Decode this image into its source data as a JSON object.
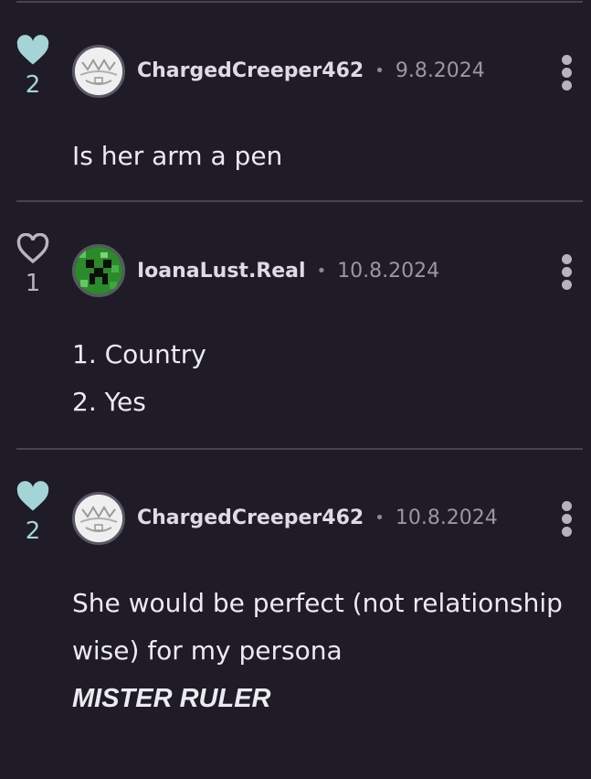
{
  "comments": [
    {
      "username": "ChargedCreeper462",
      "separator": "•",
      "date": "9.8.2024",
      "likes": "2",
      "liked": true,
      "avatar_icon": "white-pattern-avatar",
      "lines": [
        "Is her arm a pen"
      ]
    },
    {
      "username": "IoanaLust.Real",
      "separator": "•",
      "date": "10.8.2024",
      "likes": "1",
      "liked": false,
      "avatar_icon": "creeper-face-avatar",
      "lines": [
        "1. Country",
        "2. Yes"
      ]
    },
    {
      "username": "ChargedCreeper462",
      "separator": "•",
      "date": "10.8.2024",
      "likes": "2",
      "liked": true,
      "avatar_icon": "white-pattern-avatar",
      "lines": [
        "She would be perfect (not relationship wise) for my persona"
      ],
      "emphasis": "MISTER RULER"
    }
  ],
  "colors": {
    "background": "#1f1b27",
    "liked_heart": "#a4d4d6",
    "divider": "#47434f"
  }
}
